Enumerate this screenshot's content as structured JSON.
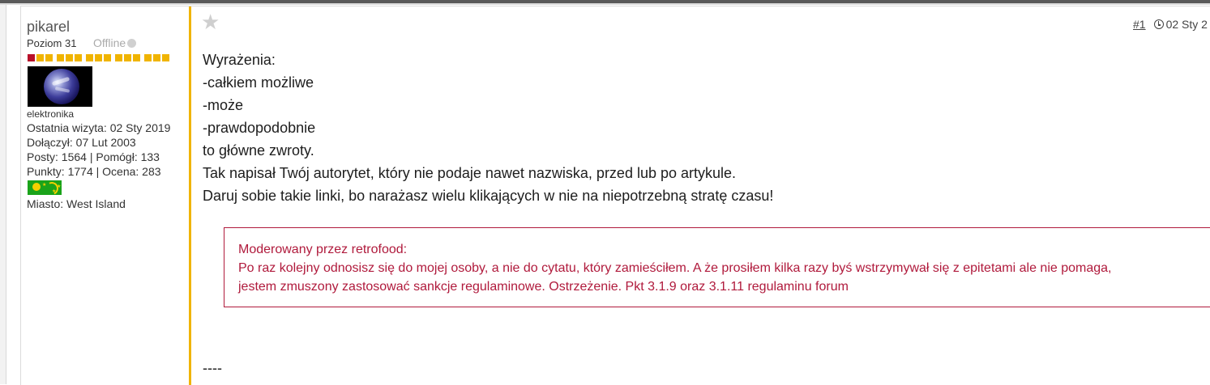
{
  "author": {
    "username": "pikarel",
    "level": "Poziom 31",
    "status": "Offline",
    "rank_segments": 15,
    "avatar_caption": "elektronika",
    "last_visit": "Ostatnia wizyta: 02 Sty 2019",
    "joined": "Dołączył: 07 Lut 2003",
    "posts_helped": "Posty: 1564 | Pomógł: 133",
    "points_rating": "Punkty: 1774 | Ocena: 283",
    "city": "Miasto: West Island"
  },
  "post": {
    "number": "#1",
    "date": "02 Sty 2",
    "lines": [
      "Wyrażenia:",
      "-całkiem możliwe",
      "-może",
      "-prawdopodobnie",
      "to główne zwroty.",
      "Tak napisał Twój autorytet, który nie podaje nawet nazwiska, przed lub po artykule.",
      "Daruj sobie takie linki, bo narażasz wielu klikających w nie na niepotrzebną stratę czasu!"
    ],
    "moderation": {
      "header": "Moderowany przez retrofood:",
      "line1": "Po raz kolejny odnosisz się do mojej osoby, a nie do cytatu, który zamieściłem. A że prosiłem kilka razy byś wstrzymywał się z epitetami ale nie pomaga,",
      "line2": "jestem zmuszony zastosować sankcje regulaminowe. Ostrzeżenie. Pkt 3.1.9 oraz 3.1.11 regulaminu forum"
    },
    "signature": "----"
  },
  "colors": {
    "accent_divider": "#f0b400",
    "moderation": "#b01a3c",
    "rank_first": "#b8102a",
    "rank": "#f0b400"
  },
  "icons": [
    "star-icon",
    "clock-icon",
    "status-dot-icon",
    "flag-icon"
  ]
}
